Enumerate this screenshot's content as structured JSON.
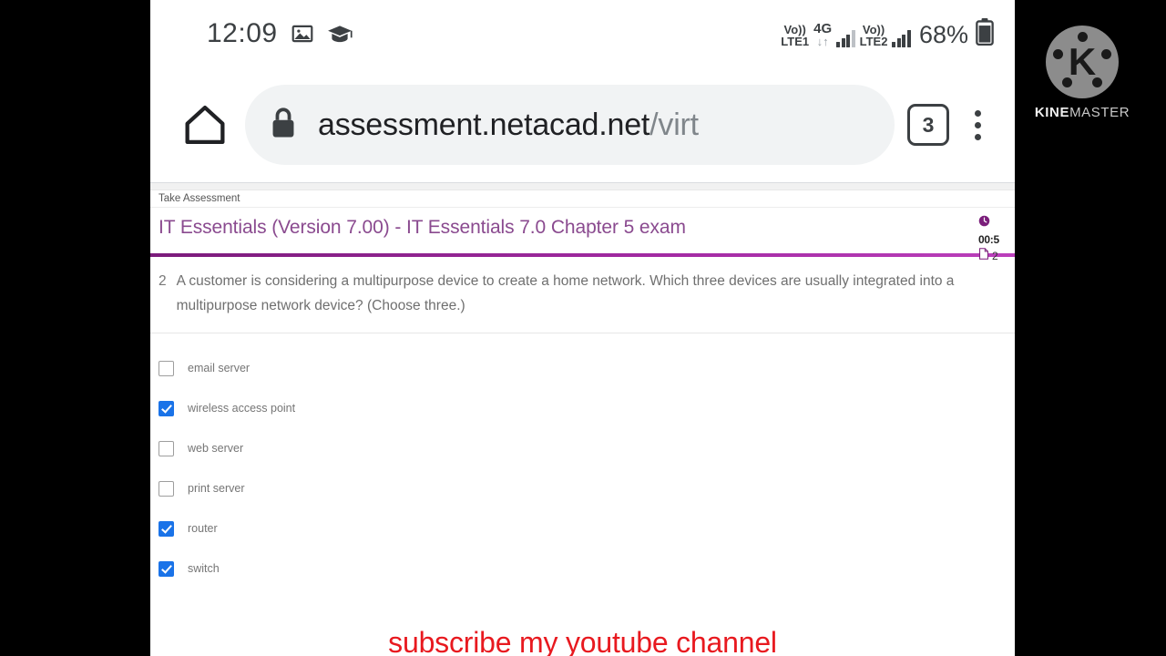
{
  "status_bar": {
    "clock": "12:09",
    "left_icons": [
      "image-icon",
      "graduation-cap-icon"
    ],
    "sim1_volte_top": "Vo))",
    "sim1_volte_bottom": "LTE1",
    "network_type": "4G",
    "data_arrows": "↓↑",
    "sim2_volte_top": "Vo))",
    "sim2_volte_bottom": "LTE2",
    "battery_percent": "68%",
    "battery_icon": "battery-icon"
  },
  "browser": {
    "home_icon": "home-icon",
    "lock_icon": "lock-icon",
    "url_domain": "assessment.netacad.net",
    "url_path": "/virt",
    "url_full": "assessment.netacad.net/virt",
    "tab_count": "3",
    "menu_icon": "overflow-menu-icon"
  },
  "page": {
    "breadcrumb": "Take Assessment",
    "exam_title": "IT Essentials (Version 7.00) - IT Essentials 7.0 Chapter 5 exam",
    "timer_icon": "clock-icon",
    "timer_value": "00:5",
    "pages_icon": "page-icon",
    "pages_value": "2",
    "accent_color": "#8e1e8e"
  },
  "question": {
    "number": "2",
    "text": "A customer is considering a multipurpose device to create a home network. Which three devices are usually integrated into a multipurpose network device? (Choose three.)",
    "options": [
      {
        "label": "email server",
        "checked": false
      },
      {
        "label": "wireless access point",
        "checked": true
      },
      {
        "label": "web server",
        "checked": false
      },
      {
        "label": "print server",
        "checked": false
      },
      {
        "label": "router",
        "checked": true
      },
      {
        "label": "switch",
        "checked": true
      }
    ],
    "checkbox_checked_color": "#1a73e8"
  },
  "overlay": {
    "subscribe_text": "subscribe my youtube channel",
    "subscribe_color": "#e8191f",
    "watermark_brand_bold": "KINE",
    "watermark_brand_light": "MASTER",
    "watermark_letter": "K"
  }
}
